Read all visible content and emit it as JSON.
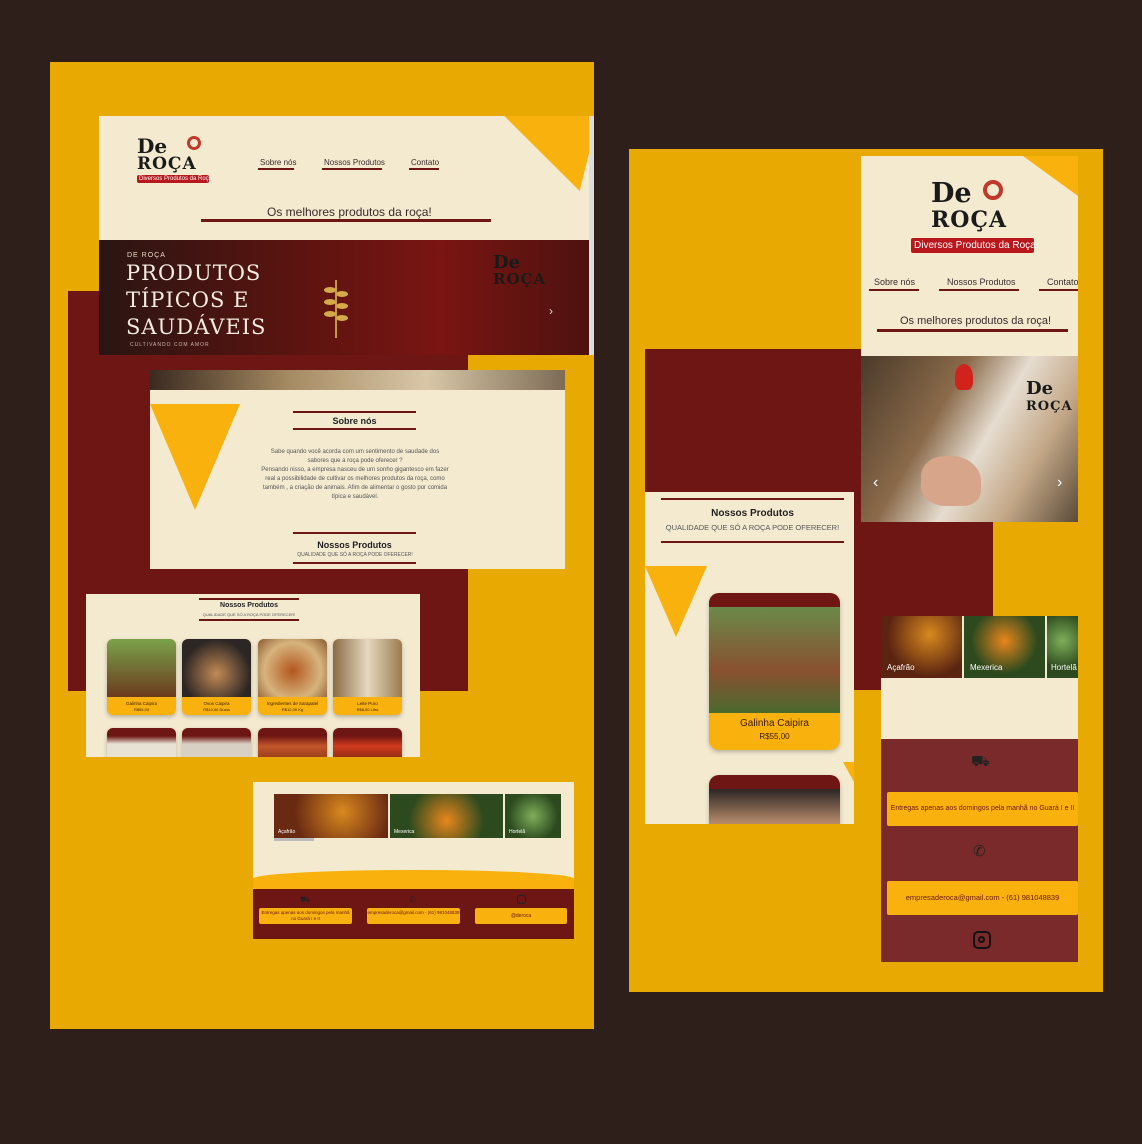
{
  "desktop": {
    "logo": {
      "de": "De",
      "roca": "ROÇA",
      "tagline": "Diversos Produtos da Roça"
    },
    "nav": [
      "Sobre nós",
      "Nossos Produtos",
      "Contato"
    ],
    "subtitle": "Os melhores produtos da roça!",
    "hero": {
      "kicker": "DE ROÇA",
      "line1": "PRODUTOS",
      "line2": "TÍPICOS E",
      "line3": "SAUDÁVEIS",
      "footer": "CULTIVANDO COM AMOR",
      "logo_de": "De",
      "logo_roca": "ROÇA"
    },
    "about": {
      "title": "Sobre nós",
      "text1": "Sabe quando você acorda com um sentimento de saudade dos sabores que a roça pode oferecer ?",
      "text2": "Pensando nisso, a empresa nasceu de um sonho gigantesco em fazer real a possibilidade de cultivar os melhores produtos da roça, como também , a criação de animais. Afim de alimentar o gosto por comida típica e saudável."
    },
    "products_section": {
      "title": "Nossos Produtos",
      "subtitle": "QUALIDADE QUE SÓ A ROÇA PODE OFERECER!"
    },
    "products": [
      {
        "name": "Galinha Caipira",
        "price": "R$55,00"
      },
      {
        "name": "Ovos Caipira",
        "price": "R$10,00 Dúzia"
      },
      {
        "name": "Ingredientes de Sarapatel",
        "price": "R$12,00 Kg"
      },
      {
        "name": "Leite Puro",
        "price": "R$8,00 Litro"
      }
    ],
    "spices": [
      "Açafrão",
      "Mexerica",
      "Hortelã"
    ],
    "footer": {
      "delivery": "Entregas apenas aos domingos pela manhã no Guará I e II",
      "contact": "empresaderoca@gmail.com - (61) 981048839",
      "instagram": "@deroca"
    }
  },
  "mobile": {
    "logo": {
      "de": "De",
      "roca": "ROÇA",
      "tagline": "Diversos Produtos da Roça"
    },
    "nav": [
      "Sobre nós",
      "Nossos Produtos",
      "Contato"
    ],
    "subtitle": "Os melhores produtos da roça!",
    "hero_logo": {
      "de": "De",
      "roca": "ROÇA"
    },
    "products_section": {
      "title": "Nossos Produtos",
      "subtitle": "QUALIDADE QUE SÓ A ROÇA PODE OFERECER!"
    },
    "product": {
      "name": "Galinha Caipira",
      "price": "R$55,00"
    },
    "spices": [
      "Açafrão",
      "Mexerica",
      "Hortelã"
    ],
    "footer": {
      "delivery": "Entregas apenas aos domingos pela manhã no Guará I e II",
      "contact": "empresaderoca@gmail.com - (61) 981048839"
    }
  },
  "colors": {
    "background": "#2e1f1a",
    "board": "#e7a902",
    "maroon": "#6e1613",
    "cream": "#f3ead0",
    "accent": "#f9b20d"
  }
}
